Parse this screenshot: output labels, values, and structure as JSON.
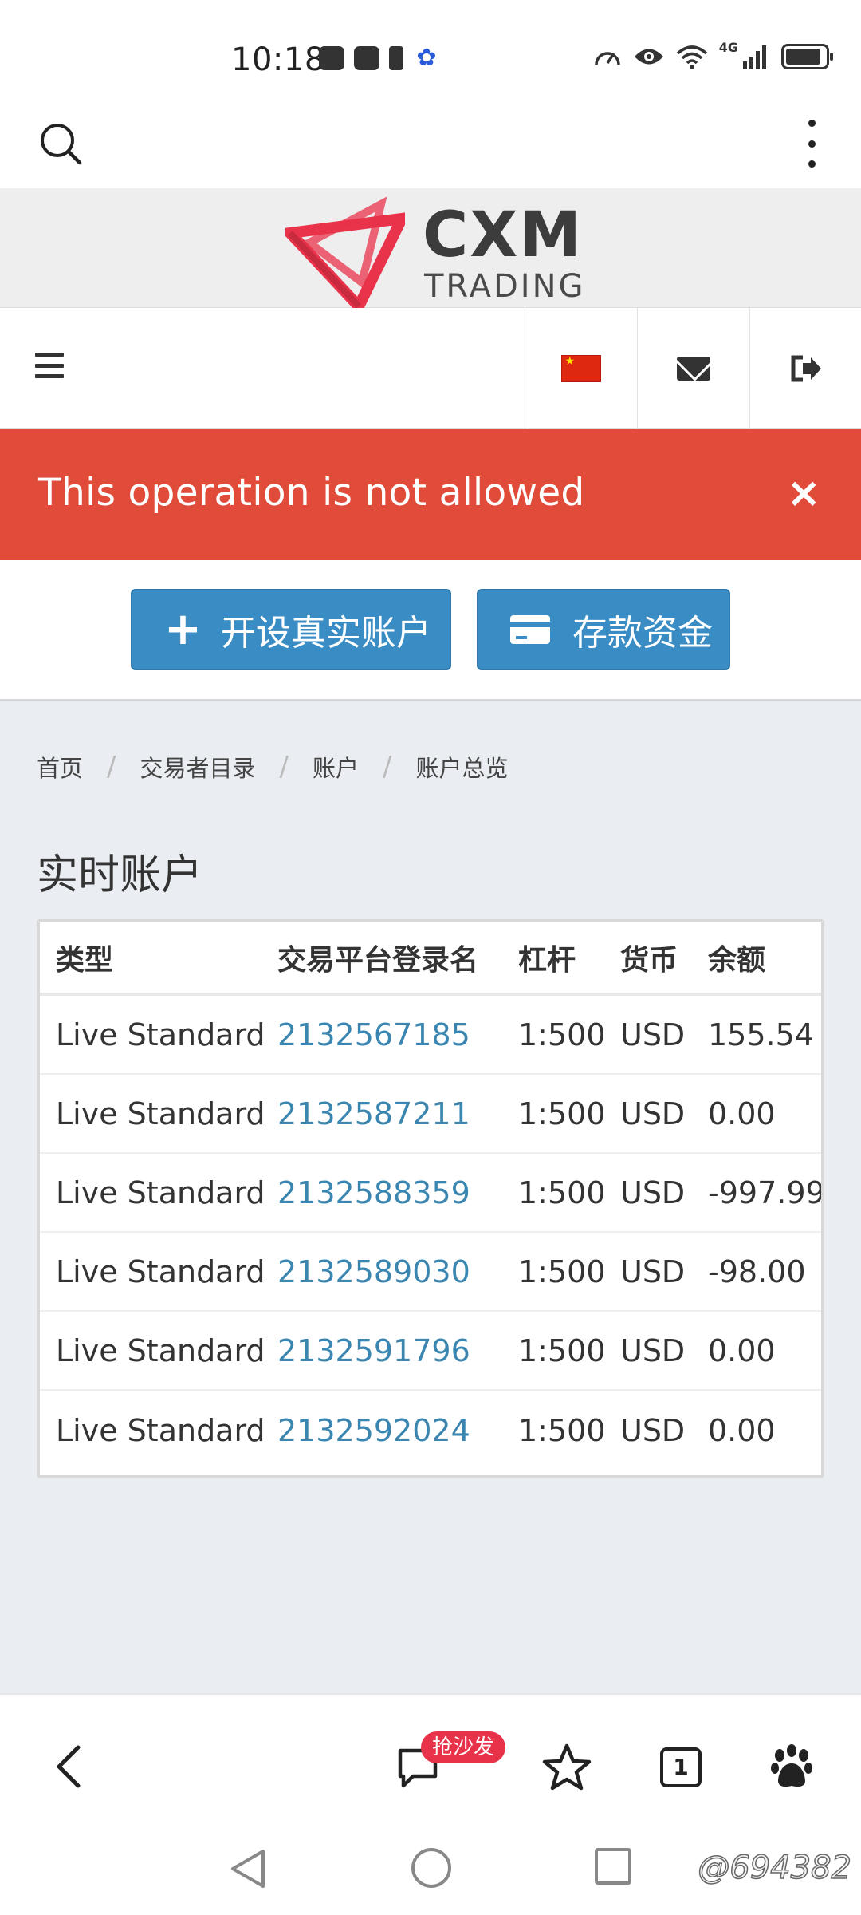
{
  "status_bar": {
    "time": "10:18",
    "network_label": "4G",
    "battery_level": 0.9,
    "icons": [
      "huawei-notification-icon",
      "huawei-notification-icon",
      "battery-alert-icon",
      "baidu-paw-icon",
      "speedometer-icon",
      "eye-icon",
      "wifi-icon",
      "signal-icon",
      "battery-icon"
    ]
  },
  "browser_top": {
    "icons": [
      "search-icon",
      "more-vertical-icon"
    ]
  },
  "site_header": {
    "logo_word": "CXM",
    "logo_sub": "TRADING",
    "brand_color": "#e8334a"
  },
  "nav": {
    "icons": [
      "hamburger-menu-icon",
      "china-flag-icon",
      "mail-icon",
      "logout-icon"
    ]
  },
  "alert": {
    "message": "This operation is not allowed",
    "close_glyph": "×",
    "color": "#e04b3a"
  },
  "actions": {
    "open_account": "开设真实账户",
    "deposit": "存款资金",
    "button_color": "#3a8dc4"
  },
  "breadcrumb": {
    "items": [
      "首页",
      "交易者目录",
      "账户",
      "账户总览"
    ],
    "separator": "/"
  },
  "section_title": "实时账户",
  "accounts_table": {
    "columns": [
      "类型",
      "交易平台登录名",
      "杠杆",
      "货币",
      "余额"
    ],
    "rows": [
      {
        "type": "Live Standard",
        "login": "2132567185",
        "leverage": "1:500",
        "currency": "USD",
        "balance": "155.54"
      },
      {
        "type": "Live Standard",
        "login": "2132587211",
        "leverage": "1:500",
        "currency": "USD",
        "balance": "0.00"
      },
      {
        "type": "Live Standard",
        "login": "2132588359",
        "leverage": "1:500",
        "currency": "USD",
        "balance": "-997.99"
      },
      {
        "type": "Live Standard",
        "login": "2132589030",
        "leverage": "1:500",
        "currency": "USD",
        "balance": "-98.00"
      },
      {
        "type": "Live Standard",
        "login": "2132591796",
        "leverage": "1:500",
        "currency": "USD",
        "balance": "0.00"
      },
      {
        "type": "Live Standard",
        "login": "2132592024",
        "leverage": "1:500",
        "currency": "USD",
        "balance": "0.00"
      }
    ],
    "link_color": "#3a86b0"
  },
  "bottom_bar": {
    "comment_badge": "抢沙发",
    "tab_count": "1",
    "icons": [
      "back-arrow-icon",
      "comment-icon",
      "star-icon",
      "tabs-icon",
      "baidu-du-icon"
    ]
  },
  "system_nav": {
    "icons": [
      "nav-back-icon",
      "nav-home-icon",
      "nav-recents-icon"
    ]
  },
  "watermark": "@694382"
}
